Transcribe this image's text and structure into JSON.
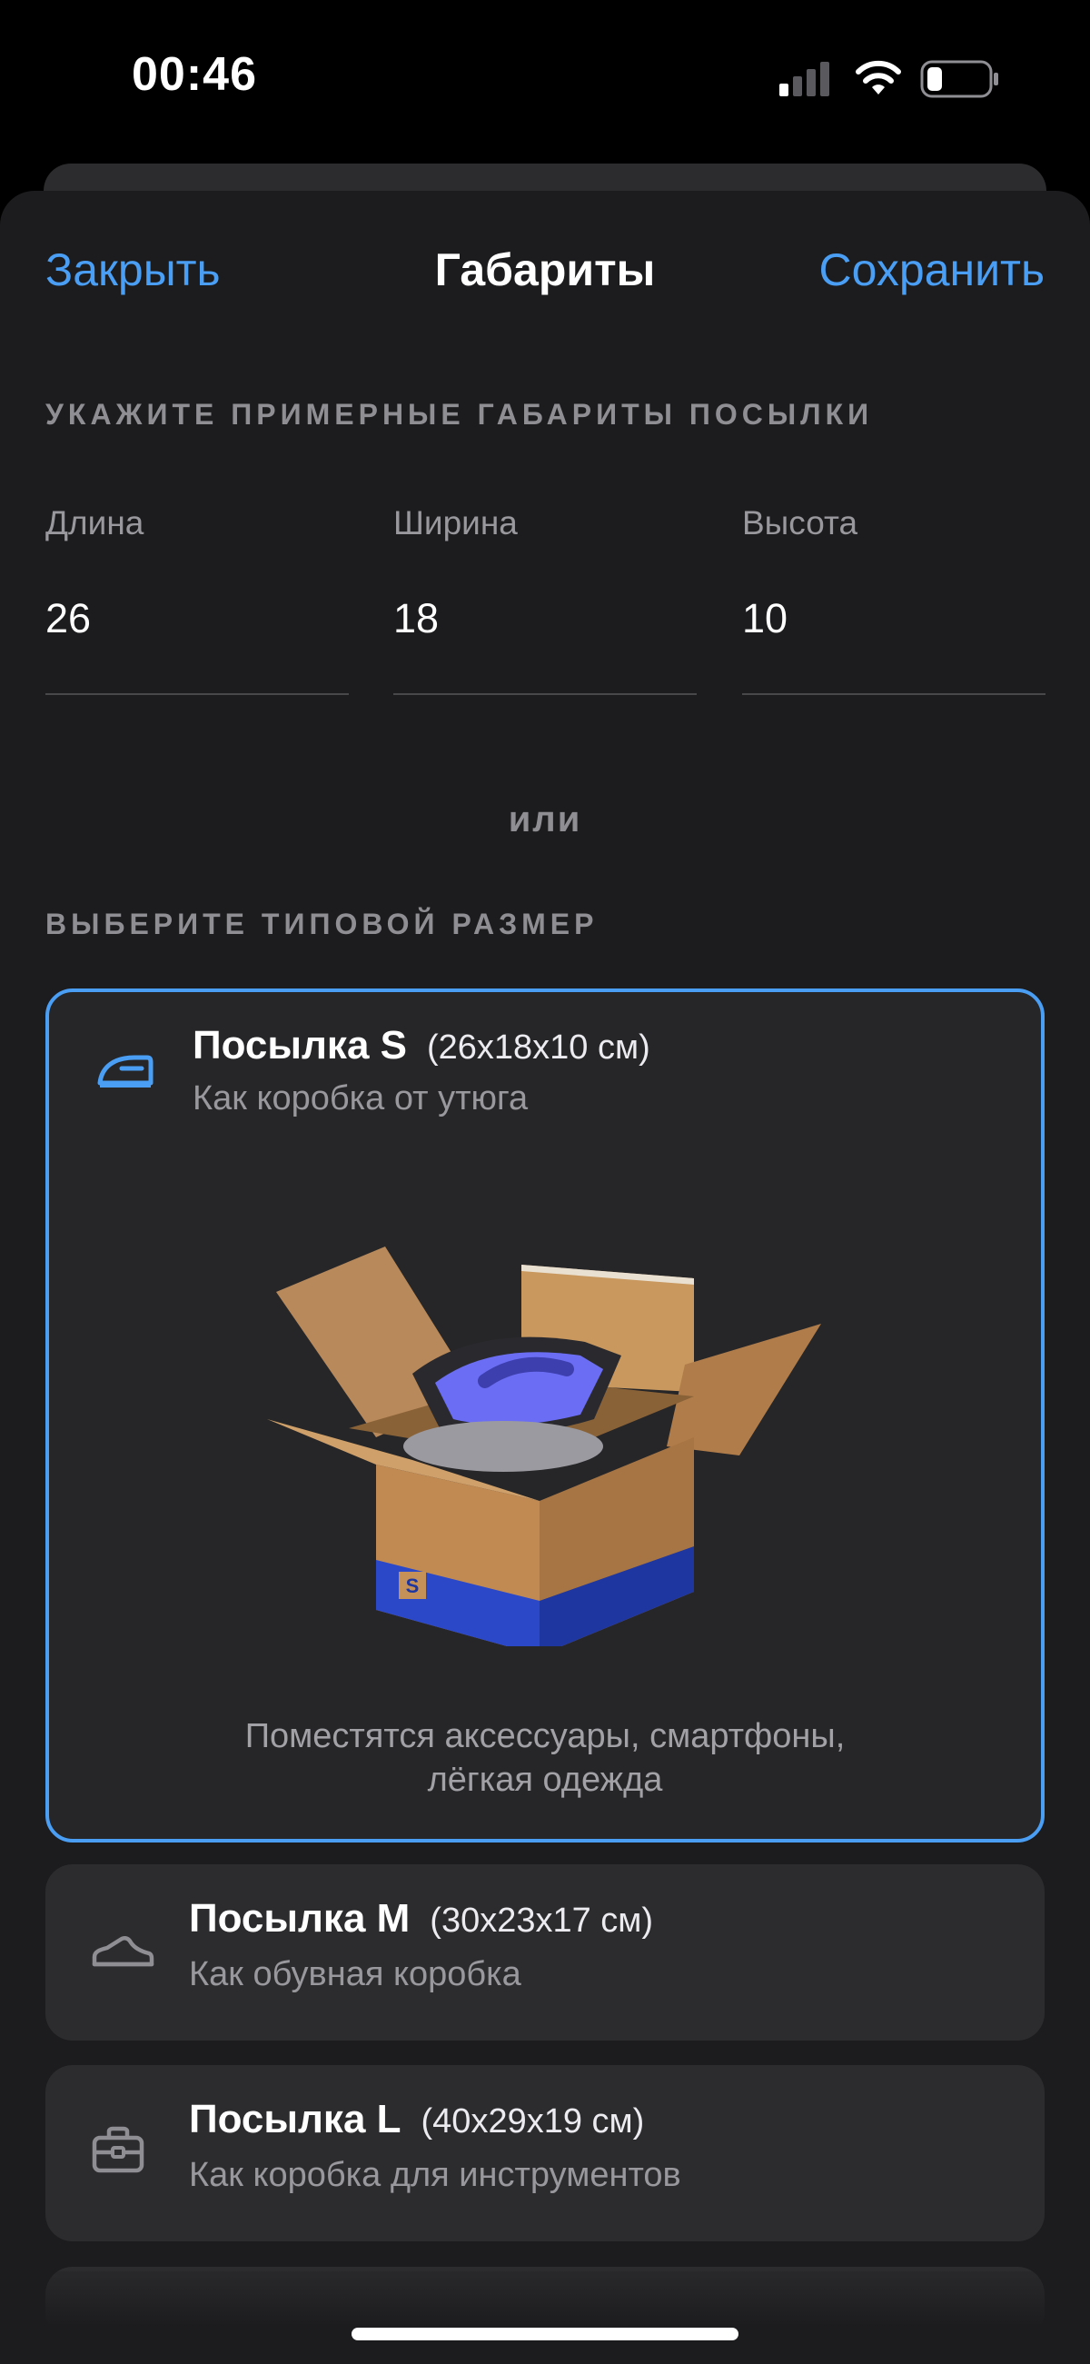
{
  "status_bar": {
    "time": "00:46",
    "icons": [
      "signal-icon",
      "wifi-icon",
      "battery-icon"
    ]
  },
  "nav": {
    "close_label": "Закрыть",
    "title": "Габариты",
    "save_label": "Сохранить"
  },
  "dimensions": {
    "section_label": "УКАЖИТЕ ПРИМЕРНЫЕ ГАБАРИТЫ ПОСЫЛКИ",
    "fields": [
      {
        "label": "Длина",
        "value": "26"
      },
      {
        "label": "Ширина",
        "value": "18"
      },
      {
        "label": "Высота",
        "value": "10"
      }
    ]
  },
  "or_label": "или",
  "presets": {
    "section_label": "ВЫБЕРИТЕ ТИПОВОЙ РАЗМЕР",
    "options": [
      {
        "title": "Посылка S",
        "dims": "(26x18x10 см)",
        "subtitle": "Как коробка от утюга",
        "description_line1": "Поместятся аксессуары, смартфоны,",
        "description_line2": "лёгкая одежда",
        "icon": "iron-icon",
        "selected": true,
        "box_badge": "S"
      },
      {
        "title": "Посылка M",
        "dims": "(30x23x17 см)",
        "subtitle": "Как обувная коробка",
        "icon": "shoe-icon",
        "selected": false
      },
      {
        "title": "Посылка L",
        "dims": "(40x29x19 см)",
        "subtitle": "Как коробка для инструментов",
        "icon": "toolbox-icon",
        "selected": false
      }
    ]
  },
  "colors": {
    "accent": "#4a9ff5",
    "background": "#1c1c1e",
    "card": "#2c2c2e"
  }
}
